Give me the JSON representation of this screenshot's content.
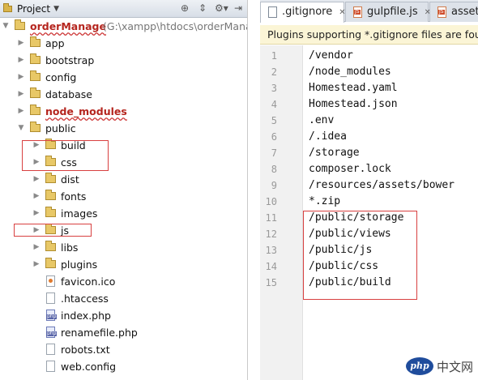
{
  "project_panel": {
    "title": "Project",
    "header_icons": [
      "target-icon",
      "sort-icon",
      "settings-icon",
      "hide-icon"
    ],
    "tree": [
      {
        "label": "orderManage",
        "path": "(G:\\xampp\\htdocs\\orderManag",
        "type": "folder",
        "level": 0,
        "expanded": true,
        "style": "bold-red"
      },
      {
        "label": "app",
        "type": "folder",
        "level": 1,
        "expanded": false
      },
      {
        "label": "bootstrap",
        "type": "folder",
        "level": 1,
        "expanded": false
      },
      {
        "label": "config",
        "type": "folder",
        "level": 1,
        "expanded": false
      },
      {
        "label": "database",
        "type": "folder",
        "level": 1,
        "expanded": false
      },
      {
        "label": "node_modules",
        "type": "folder",
        "level": 1,
        "expanded": false,
        "style": "bold-red"
      },
      {
        "label": "public",
        "type": "folder",
        "level": 1,
        "expanded": true
      },
      {
        "label": "build",
        "type": "folder",
        "level": 2,
        "expanded": false
      },
      {
        "label": "css",
        "type": "folder",
        "level": 2,
        "expanded": false
      },
      {
        "label": "dist",
        "type": "folder",
        "level": 2,
        "expanded": false
      },
      {
        "label": "fonts",
        "type": "folder",
        "level": 2,
        "expanded": false
      },
      {
        "label": "images",
        "type": "folder",
        "level": 2,
        "expanded": false
      },
      {
        "label": "js",
        "type": "folder",
        "level": 2,
        "expanded": false
      },
      {
        "label": "libs",
        "type": "folder",
        "level": 2,
        "expanded": false
      },
      {
        "label": "plugins",
        "type": "folder",
        "level": 2,
        "expanded": false
      },
      {
        "label": "favicon.ico",
        "type": "file-ico",
        "level": 2
      },
      {
        "label": ".htaccess",
        "type": "file",
        "level": 2
      },
      {
        "label": "index.php",
        "type": "file-php",
        "level": 2
      },
      {
        "label": "renamefile.php",
        "type": "file-php",
        "level": 2
      },
      {
        "label": "robots.txt",
        "type": "file",
        "level": 2
      },
      {
        "label": "web.config",
        "type": "file",
        "level": 2
      }
    ]
  },
  "editor": {
    "tabs": [
      {
        "label": ".gitignore",
        "icon": "text-file-icon",
        "active": true,
        "closable": true
      },
      {
        "label": "gulpfile.js",
        "icon": "js-file-icon",
        "active": false,
        "closable": true
      },
      {
        "label": "assets",
        "icon": "js-file-icon",
        "active": false,
        "closable": false
      }
    ],
    "notice": "Plugins supporting *.gitignore files are found",
    "lines": [
      {
        "n": "1",
        "text": "/vendor"
      },
      {
        "n": "2",
        "text": "/node_modules"
      },
      {
        "n": "3",
        "text": "Homestead.yaml"
      },
      {
        "n": "4",
        "text": "Homestead.json"
      },
      {
        "n": "5",
        "text": ".env"
      },
      {
        "n": "6",
        "text": "/.idea"
      },
      {
        "n": "7",
        "text": "/storage"
      },
      {
        "n": "8",
        "text": "composer.lock"
      },
      {
        "n": "9",
        "text": "/resources/assets/bower"
      },
      {
        "n": "10",
        "text": "*.zip"
      },
      {
        "n": "11",
        "text": "/public/storage"
      },
      {
        "n": "12",
        "text": "/public/views"
      },
      {
        "n": "13",
        "text": "/public/js"
      },
      {
        "n": "14",
        "text": "/public/css"
      },
      {
        "n": "15",
        "text": "/public/build"
      }
    ]
  },
  "watermark": {
    "logo": "php",
    "text": "中文网"
  },
  "colors": {
    "highlight_box": "#d84040",
    "error_text": "#b5251e"
  }
}
